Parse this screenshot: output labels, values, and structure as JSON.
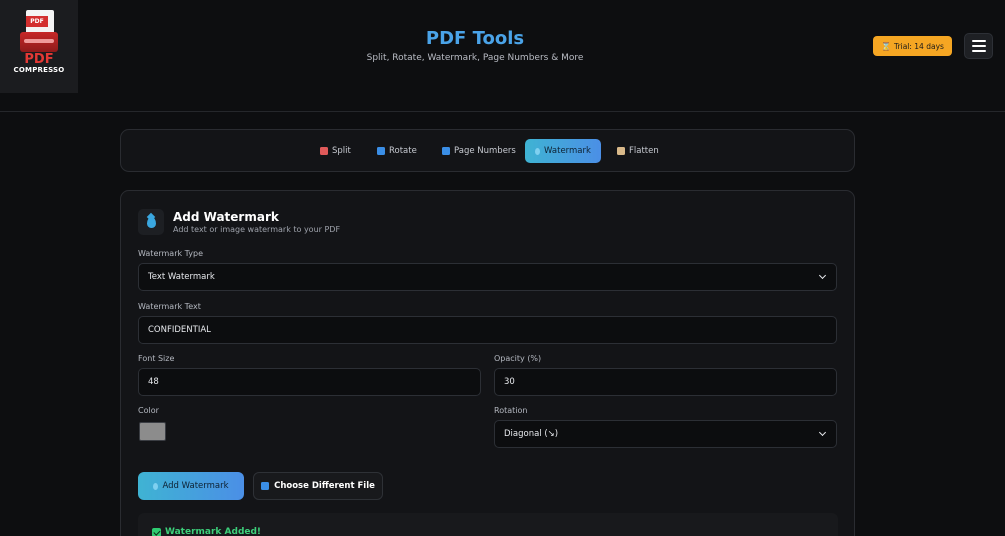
{
  "brand": {
    "logo_band": "PDF",
    "logo_pdf": "PDF",
    "logo_name": "COMPRESSO"
  },
  "header": {
    "title": "PDF Tools",
    "subtitle": "Split, Rotate, Watermark, Page Numbers & More"
  },
  "trial": {
    "icon": "hourglass-icon",
    "label": "Trial: 14 days"
  },
  "menu": {
    "icon": "hamburger-menu-icon"
  },
  "tabs": [
    {
      "label": "Split",
      "icon": "scissors-icon",
      "color": "#e05a5a",
      "active": false
    },
    {
      "label": "Rotate",
      "icon": "rotate-icon",
      "color": "#3a8ee6",
      "active": false
    },
    {
      "label": "Page Numbers",
      "icon": "numbers-icon",
      "color": "#3a8ee6",
      "active": false
    },
    {
      "label": "Watermark",
      "icon": "droplet-icon",
      "color": "#3aa7e0",
      "active": true
    },
    {
      "label": "Flatten",
      "icon": "clipboard-icon",
      "color": "#d9b98a",
      "active": false
    }
  ],
  "section": {
    "title": "Add Watermark",
    "subtitle": "Add text or image watermark to your PDF"
  },
  "form": {
    "type_label": "Watermark Type",
    "type_value": "Text Watermark",
    "text_label": "Watermark Text",
    "text_value": "CONFIDENTIAL",
    "font_size_label": "Font Size",
    "font_size_value": "48",
    "opacity_label": "Opacity (%)",
    "opacity_value": "30",
    "color_label": "Color",
    "color_value": "#8c8c8c",
    "rotation_label": "Rotation",
    "rotation_value": "Diagonal (↘)"
  },
  "actions": {
    "add_label": "Add Watermark",
    "choose_label": "Choose Different File"
  },
  "result": {
    "label": "Watermark Added!"
  }
}
